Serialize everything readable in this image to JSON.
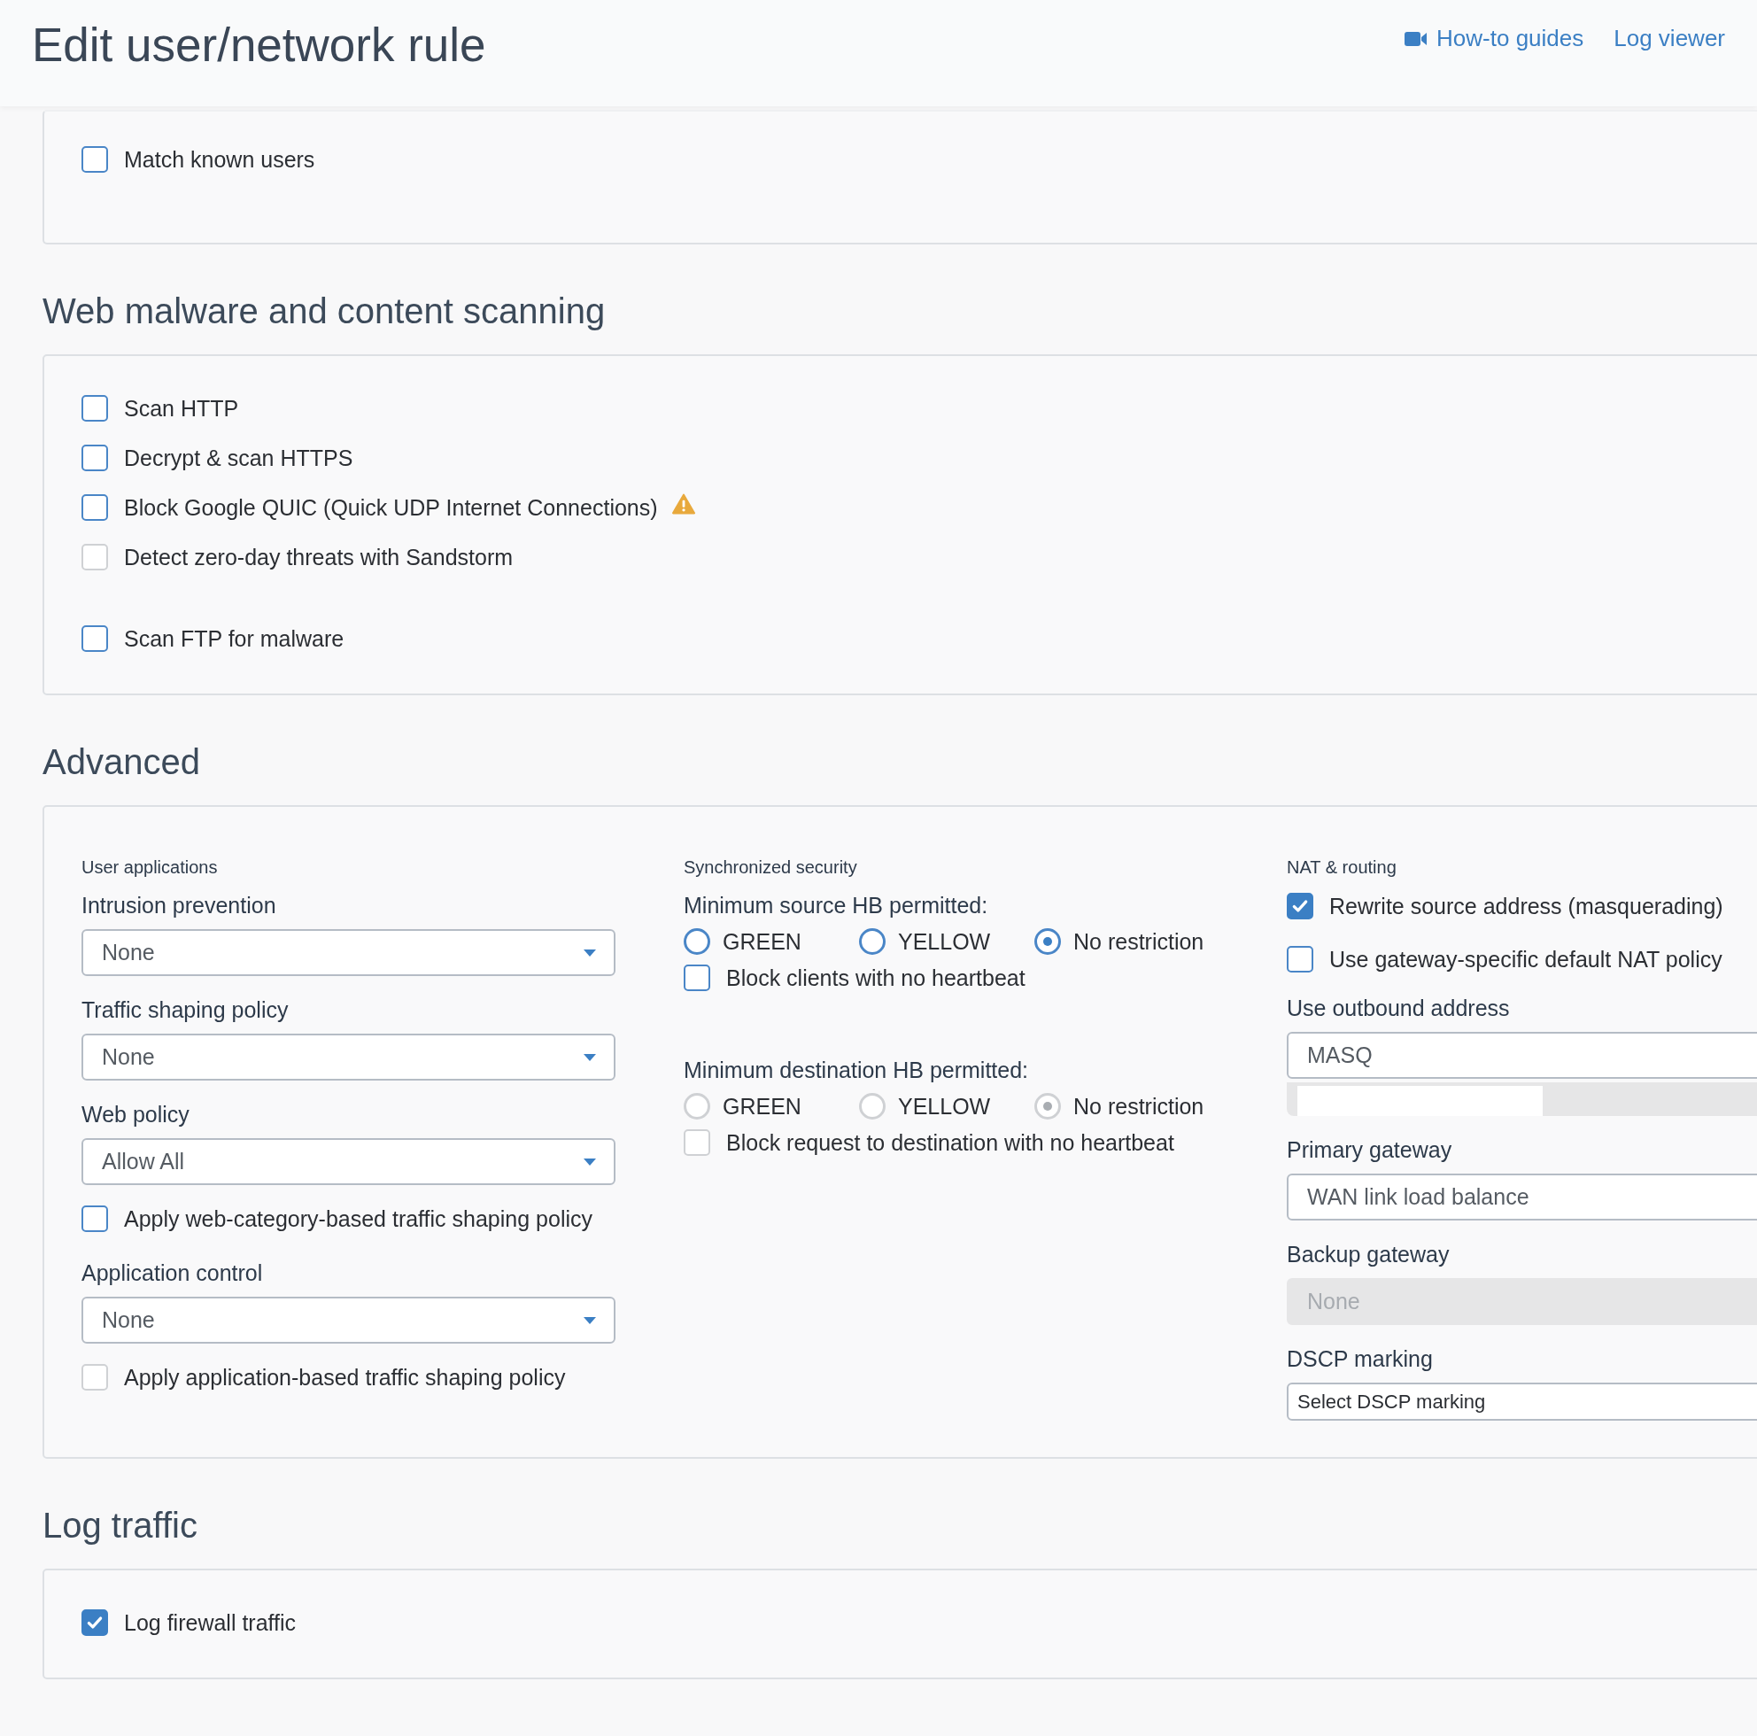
{
  "header": {
    "title": "Edit user/network rule",
    "links": [
      {
        "kind": "video",
        "label": "How-to guides"
      },
      {
        "kind": "text",
        "label": "Log viewer"
      }
    ]
  },
  "sections": [
    {
      "kind": "checklist",
      "items": [
        {
          "label": "Match known users",
          "checked": false,
          "disabled": false,
          "warning": false
        }
      ]
    },
    {
      "kind": "checklist",
      "title": "Web malware and content scanning",
      "items": [
        {
          "label": "Scan HTTP",
          "checked": false,
          "disabled": false,
          "warning": false
        },
        {
          "label": "Decrypt & scan HTTPS",
          "checked": false,
          "disabled": false,
          "warning": false
        },
        {
          "label": "Block Google QUIC (Quick UDP Internet Connections)",
          "checked": false,
          "disabled": false,
          "warning": true
        },
        {
          "label": "Detect zero-day threats with Sandstorm",
          "checked": false,
          "disabled": true,
          "warning": false
        },
        {
          "label": "Scan FTP for malware",
          "checked": false,
          "disabled": false,
          "warning": false
        }
      ]
    },
    {
      "kind": "columns",
      "title": "Advanced",
      "columns": [
        {
          "heading": "User applications",
          "fields": [
            {
              "kind": "select",
              "label": "Intrusion prevention",
              "value": "None"
            },
            {
              "kind": "select",
              "label": "Traffic shaping policy",
              "value": "None"
            },
            {
              "kind": "select",
              "label": "Web policy",
              "value": "Allow All"
            },
            {
              "kind": "checkbox",
              "label": "Apply web-category-based traffic shaping policy",
              "checked": false,
              "disabled": false
            },
            {
              "kind": "select",
              "label": "Application control",
              "value": "None"
            },
            {
              "kind": "checkbox",
              "label": "Apply application-based traffic shaping policy",
              "checked": false,
              "disabled": true
            }
          ]
        },
        {
          "heading": "Synchronized security",
          "fields": [
            {
              "kind": "radio_group",
              "label": "Minimum source HB permitted:",
              "options": [
                {
                  "label": "GREEN",
                  "selected": false,
                  "disabled": false
                },
                {
                  "label": "YELLOW",
                  "selected": false,
                  "disabled": false
                },
                {
                  "label": "No restriction",
                  "selected": true,
                  "disabled": false
                }
              ]
            },
            {
              "kind": "checkbox",
              "label": "Block clients with no heartbeat",
              "checked": false,
              "disabled": false
            },
            {
              "kind": "radio_group",
              "label": "Minimum destination HB permitted:",
              "options": [
                {
                  "label": "GREEN",
                  "selected": false,
                  "disabled": true
                },
                {
                  "label": "YELLOW",
                  "selected": false,
                  "disabled": true
                },
                {
                  "label": "No restriction",
                  "selected": true,
                  "disabled": true
                }
              ]
            },
            {
              "kind": "checkbox",
              "label": "Block request to destination with no heartbeat",
              "checked": false,
              "disabled": true
            }
          ]
        },
        {
          "heading": "NAT & routing",
          "fields": [
            {
              "kind": "checkbox",
              "label": "Rewrite source address (masquerading)",
              "checked": true,
              "disabled": false
            },
            {
              "kind": "checkbox",
              "label": "Use gateway-specific default NAT policy",
              "checked": false,
              "disabled": false
            },
            {
              "kind": "input",
              "label": "Use outbound address",
              "value": "MASQ",
              "disabled": false
            },
            {
              "kind": "list_box"
            },
            {
              "kind": "input",
              "label": "Primary gateway",
              "value": "WAN link load balance",
              "disabled": false
            },
            {
              "kind": "input",
              "label": "Backup gateway",
              "value": "None",
              "disabled": true
            },
            {
              "kind": "compact_input",
              "label": "DSCP marking",
              "value": "Select DSCP marking"
            }
          ]
        }
      ]
    },
    {
      "kind": "checklist",
      "title": "Log traffic",
      "items": [
        {
          "label": "Log firewall traffic",
          "checked": true,
          "disabled": false,
          "warning": false
        }
      ]
    }
  ]
}
